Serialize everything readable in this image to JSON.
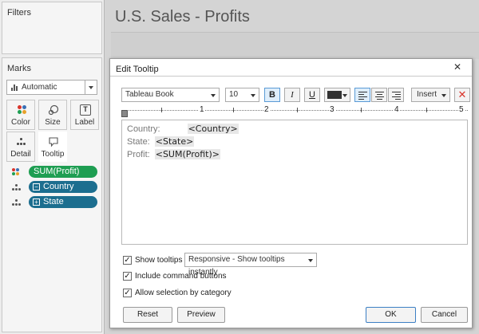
{
  "filters": {
    "title": "Filters"
  },
  "marks": {
    "title": "Marks",
    "mark_type": "Automatic",
    "buttons": {
      "color": "Color",
      "size": "Size",
      "label": "Label",
      "detail": "Detail",
      "tooltip": "Tooltip"
    },
    "pills": [
      {
        "label": "SUM(Profit)",
        "kind": "color"
      },
      {
        "label": "Country",
        "kind": "detail",
        "prefix": "−"
      },
      {
        "label": "State",
        "kind": "detail",
        "prefix": "+"
      }
    ]
  },
  "sheet": {
    "title": "U.S. Sales - Profits"
  },
  "dialog": {
    "title": "Edit Tooltip",
    "close_glyph": "✕",
    "font_family": "Tableau Book",
    "font_size": "10",
    "bold": "B",
    "italic": "I",
    "underline": "U",
    "insert_label": "Insert",
    "text_color": "#333333",
    "ruler": [
      "1",
      "2",
      "3",
      "4",
      "5"
    ],
    "lines": [
      {
        "label": "Country:",
        "field": "<Country>"
      },
      {
        "label": "State:",
        "field": "<State>"
      },
      {
        "label": "Profit:",
        "field": "<SUM(Profit)>"
      }
    ],
    "options": {
      "show_tooltips": "Show tooltips",
      "show_tooltips_mode": "Responsive - Show tooltips instantly",
      "include_command_buttons": "Include command buttons",
      "allow_selection": "Allow selection by category"
    },
    "buttons": {
      "reset": "Reset",
      "preview": "Preview",
      "ok": "OK",
      "cancel": "Cancel"
    }
  },
  "colors": {
    "measure_pill": "#1e9e52",
    "dimension_pill": "#1c6e8f",
    "accent": "#5b9bd5",
    "delete": "#d9342b"
  }
}
